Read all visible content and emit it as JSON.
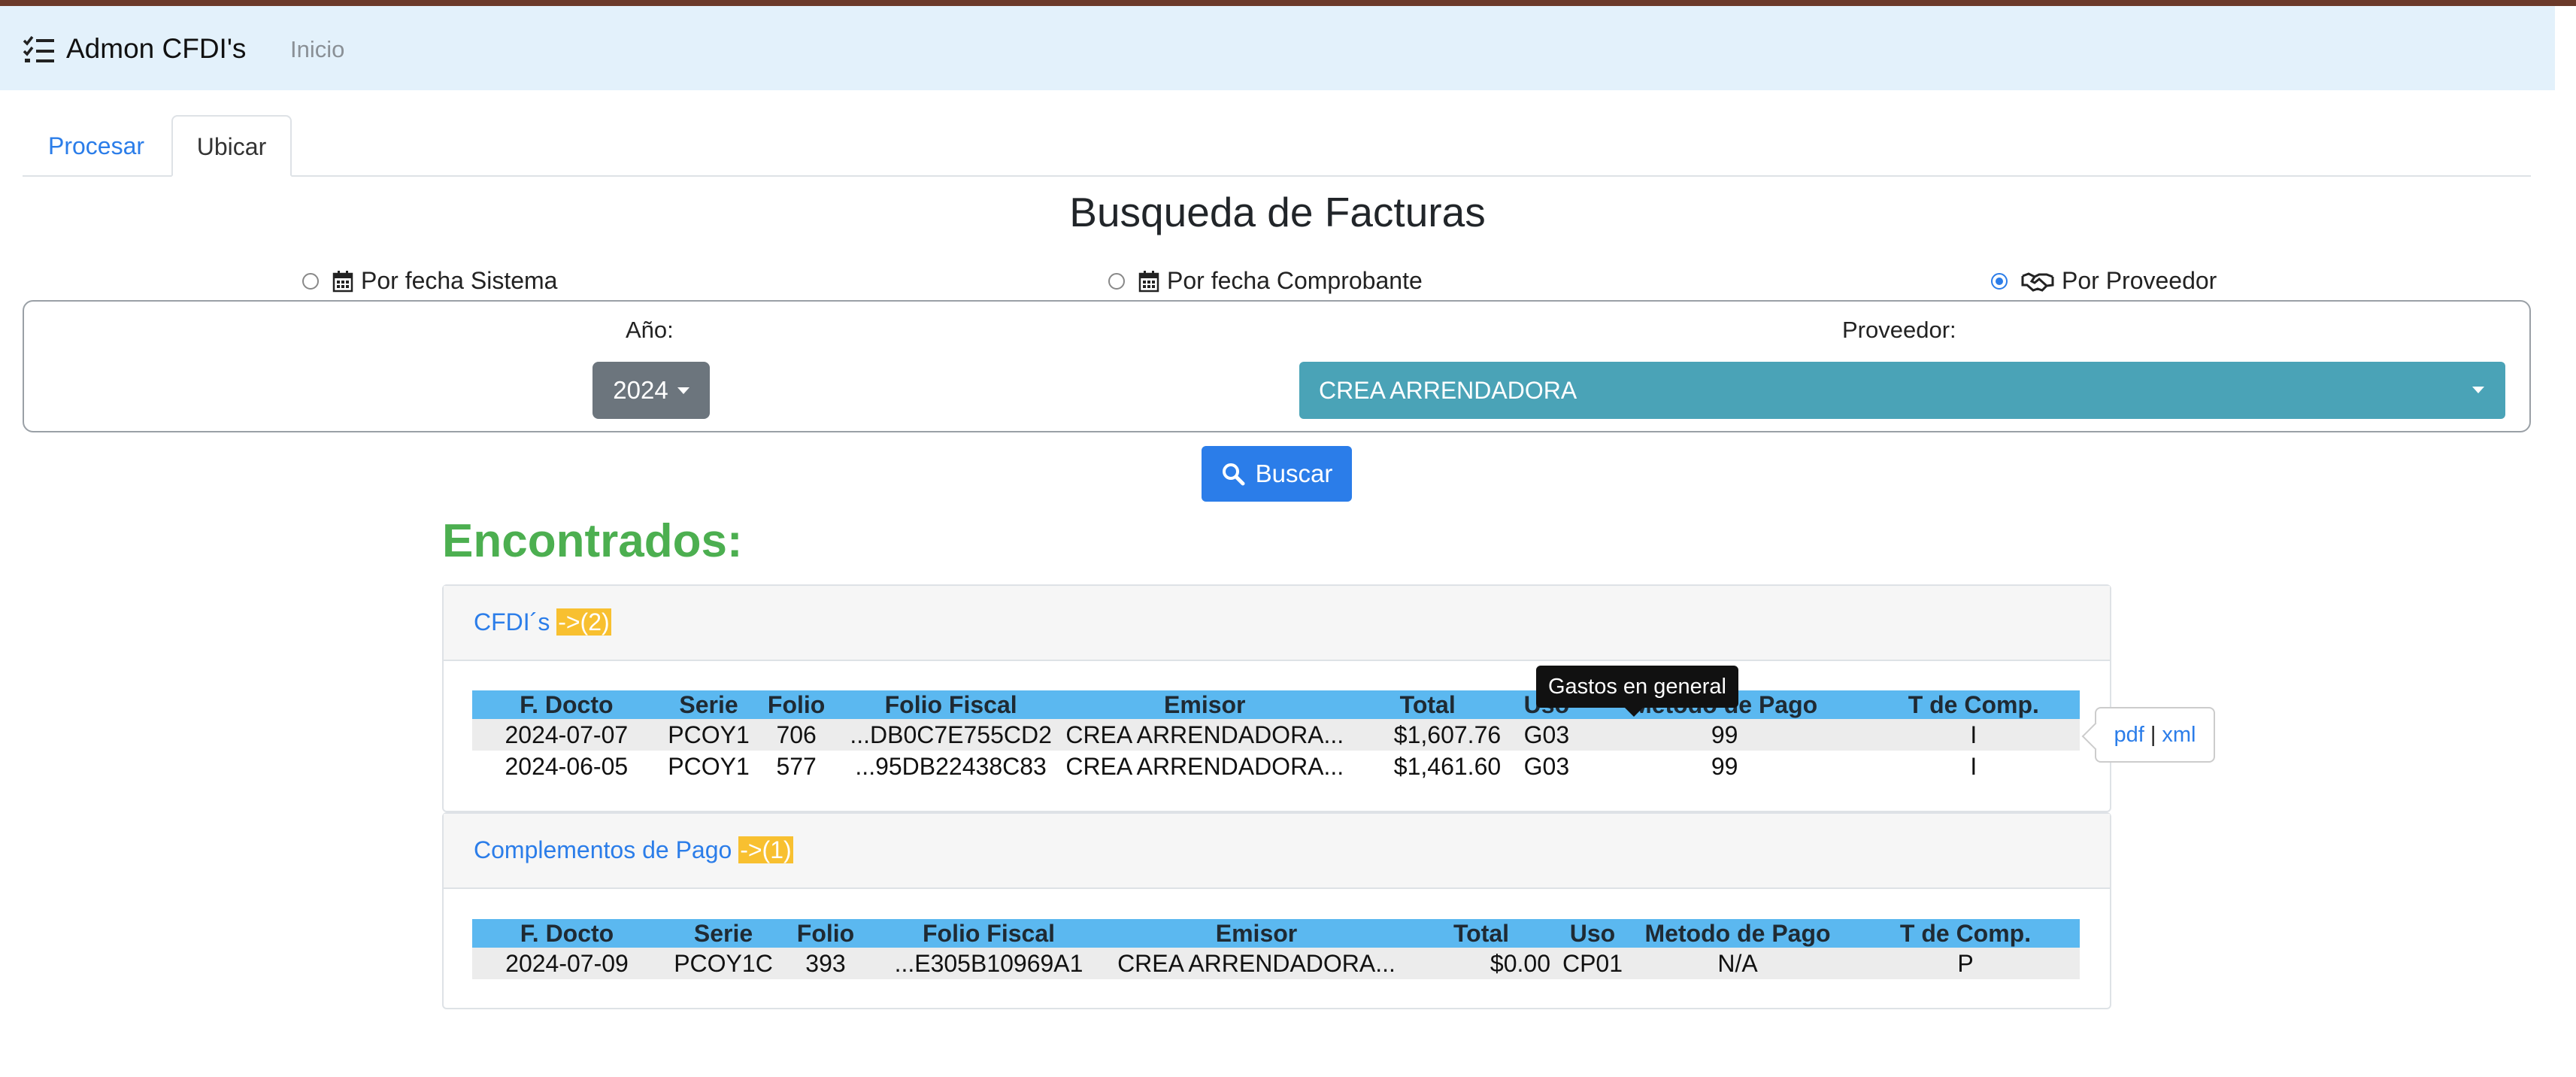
{
  "app": {
    "brand": "Admon CFDI's",
    "nav_link": "Inicio"
  },
  "tabs": [
    {
      "label": "Procesar"
    },
    {
      "label": "Ubicar"
    }
  ],
  "search": {
    "title": "Busqueda de Facturas",
    "options": [
      {
        "label": "Por fecha Sistema",
        "icon": "calendar-icon",
        "checked": false
      },
      {
        "label": "Por fecha Comprobante",
        "icon": "calendar-icon",
        "checked": false
      },
      {
        "label": "Por Proveedor",
        "icon": "handshake-icon",
        "checked": true
      }
    ],
    "year_label": "Año:",
    "year_value": "2024",
    "provider_label": "Proveedor:",
    "provider_value": "CREA ARRENDADORA",
    "search_button": "Buscar"
  },
  "results": {
    "heading": "Encontrados:",
    "cfdis": {
      "title": "CFDI´s",
      "count": "->(2)",
      "columns": [
        "F. Docto",
        "Serie",
        "Folio",
        "Folio Fiscal",
        "Emisor",
        "Total",
        "Uso",
        "Metodo de Pago",
        "T de Comp."
      ],
      "rows": [
        [
          "2024-07-07",
          "PCOY1",
          "706",
          "...DB0C7E755CD2",
          "CREA ARRENDADORA...",
          "$1,607.76",
          "G03",
          "99",
          "I"
        ],
        [
          "2024-06-05",
          "PCOY1",
          "577",
          "...95DB22438C83",
          "CREA ARRENDADORA...",
          "$1,461.60",
          "G03",
          "99",
          "I"
        ]
      ]
    },
    "complementos": {
      "title": "Complementos de Pago",
      "count": "->(1)",
      "columns": [
        "F. Docto",
        "Serie",
        "Folio",
        "Folio Fiscal",
        "Emisor",
        "Total",
        "Uso",
        "Metodo de Pago",
        "T de Comp."
      ],
      "rows": [
        [
          "2024-07-09",
          "PCOY1C",
          "393",
          "...E305B10969A1",
          "CREA ARRENDADORA...",
          "$0.00",
          "CP01",
          "N/A",
          "P"
        ]
      ]
    }
  },
  "tooltip": {
    "text": "Gastos en general"
  },
  "popover": {
    "pdf": "pdf",
    "separator": "|",
    "xml": "xml"
  }
}
